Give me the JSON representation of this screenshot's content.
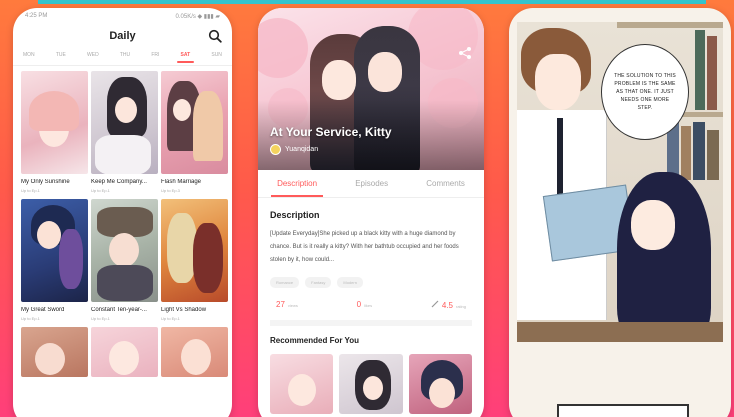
{
  "colors": {
    "accent": "#ff5a5a",
    "background_top": "#ff7a3d",
    "background_bottom": "#ff3f7a",
    "strip": "#35c4cc"
  },
  "phone1": {
    "status_time": "4:25 PM",
    "status_right": "0.05K/s ◆ ▮▮▮ ▰",
    "title": "Daily",
    "search_icon": "search-icon",
    "days": [
      "MON",
      "TUE",
      "WED",
      "THU",
      "FRI",
      "SAT",
      "SUN"
    ],
    "active_day": "SAT",
    "comics": [
      {
        "title": "My Only Sunshine",
        "sub": "Up to Ep.1"
      },
      {
        "title": "Keep Me Company...",
        "sub": "Up to Ep.1"
      },
      {
        "title": "Flash Marriage",
        "sub": "Up to Ep.3"
      },
      {
        "title": "My Great Sword",
        "sub": "Up to Ep.1"
      },
      {
        "title": "Constant Ten-year-...",
        "sub": "Up to Ep.1"
      },
      {
        "title": "Light Vs Shadow",
        "sub": "Up to Ep.1"
      },
      {
        "title": "",
        "sub": ""
      },
      {
        "title": "",
        "sub": ""
      },
      {
        "title": "",
        "sub": ""
      }
    ]
  },
  "phone2": {
    "hero_title": "At Your Service, Kitty",
    "author": "Yuanqidan",
    "share_icon": "share-icon",
    "tabs": [
      "Description",
      "Episodes",
      "Comments"
    ],
    "active_tab": "Description",
    "description_title": "Description",
    "description_text": "[Update Everyday]She picked up a black kitty with a huge diamond by chance. But is it really a kitty? With her bathtub occupied and her foods stolen by it, how could...",
    "tags": [
      "Romance",
      "Fantasy",
      "Modern"
    ],
    "stats": [
      {
        "num": "27",
        "unit": "views",
        "icon": "eye-icon"
      },
      {
        "num": "0",
        "unit": "likes",
        "icon": "heart-icon"
      },
      {
        "num": "4.5",
        "unit": "rating",
        "icon": "pen-icon"
      }
    ],
    "recommended_title": "Recommended For You"
  },
  "phone3": {
    "speech": "THE SOLUTION TO THIS PROBLEM IS THE SAME AS THAT ONE. IT JUST NEEDS ONE MORE STEP."
  }
}
